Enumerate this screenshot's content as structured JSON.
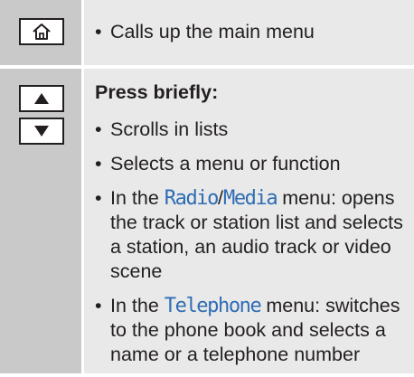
{
  "row1": {
    "key_icon": "home-icon",
    "text": "Calls up the main menu"
  },
  "row2": {
    "key_icons": [
      "arrow-up-icon",
      "arrow-down-icon"
    ],
    "heading": "Press briefly:",
    "items": [
      {
        "text": "Scrolls in lists"
      },
      {
        "text": "Selects a menu or function"
      },
      {
        "prefix": "In the ",
        "hl1": "Radio",
        "slash": "/",
        "hl2": "Media",
        "rest": " menu: opens the track or station list and selects a station, an audio track or video scene"
      },
      {
        "prefix": "In the ",
        "hl1": "Telephone",
        "rest": " menu: switches to the phone book and selects a name or a telephone number"
      }
    ]
  },
  "colors": {
    "key_column": "#c9c9c9",
    "content_background": "#e9e9e9",
    "highlight": "#2e6db4",
    "text": "#231f20"
  }
}
